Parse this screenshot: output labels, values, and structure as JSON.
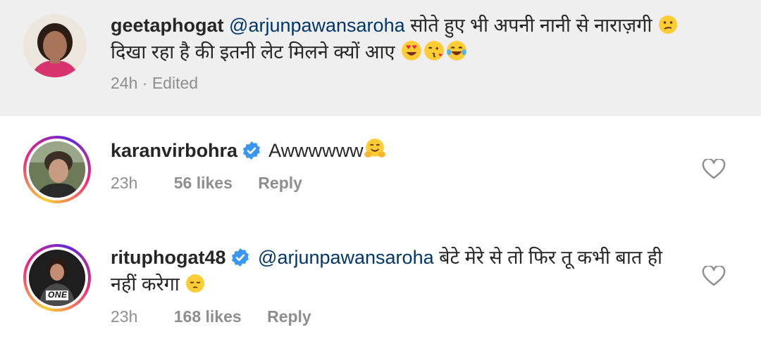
{
  "comments": [
    {
      "username": "geetaphogat",
      "mention": "@arjunpawansaroha",
      "text": " सोते हुए भी अपनी नानी से नाराज़गी ",
      "text2": "दिखा रहा है की इतनी लेट मिलने क्यों आए ",
      "emojis": [
        "confused-emoji",
        "heart-eyes-emoji",
        "kissing-heart-emoji",
        "joy-emoji"
      ],
      "time": "24h",
      "edited": "Edited",
      "verified": false
    },
    {
      "username": "karanvirbohra",
      "text": "Awwwwww",
      "emojis": [
        "hugging-emoji"
      ],
      "time": "23h",
      "likes": "56 likes",
      "reply": "Reply",
      "verified": true
    },
    {
      "username": "rituphogat48",
      "mention": "@arjunpawansaroha",
      "text": " बेटे मेरे से तो फिर  तू कभी बात ही",
      "text2": "नहीं करेगा ",
      "emojis": [
        "pensive-emoji"
      ],
      "time": "23h",
      "likes": "168 likes",
      "reply": "Reply",
      "verified": true,
      "avatar_text": "ONE"
    }
  ],
  "colors": {
    "mention": "#00376b",
    "verified": "#3897f0",
    "muted": "#8e8e8e"
  }
}
